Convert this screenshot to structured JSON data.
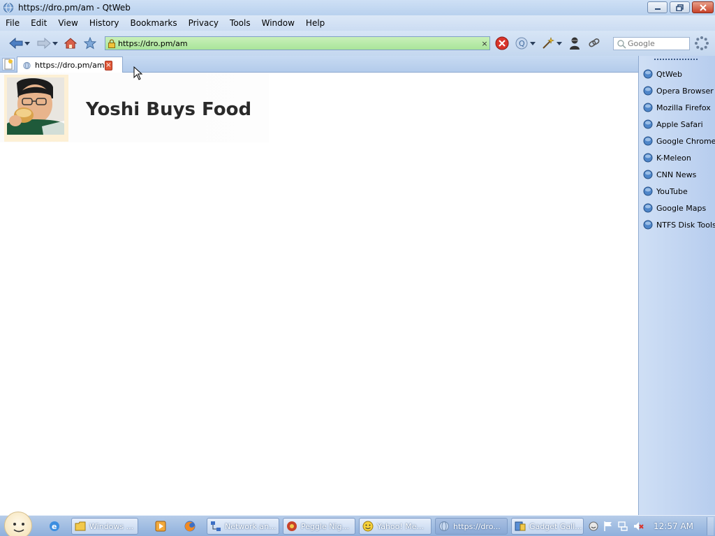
{
  "window": {
    "title": "https://dro.pm/am - QtWeb",
    "icon": "qtweb-globe-icon"
  },
  "menu": [
    "File",
    "Edit",
    "View",
    "History",
    "Bookmarks",
    "Privacy",
    "Tools",
    "Window",
    "Help"
  ],
  "toolbar": {
    "url": "https://dro.pm/am",
    "search_placeholder": "Google",
    "clear_glyph": "×",
    "url_color": "#a9e49a"
  },
  "tabs": [
    {
      "title": "https://dro.pm/am",
      "close_glyph": "×",
      "active": true
    }
  ],
  "page": {
    "site_title": "Yoshi Buys Food",
    "avatar_alt": "boy eating food"
  },
  "sidebar": {
    "bookmarks": [
      "QtWeb",
      "Opera Browser",
      "Mozilla Firefox",
      "Apple Safari",
      "Google Chrome",
      "K-Meleon",
      "CNN News",
      "YouTube",
      "Google Maps",
      "NTFS Disk Tools"
    ]
  },
  "taskbar": {
    "buttons": [
      {
        "label": "Windows ...",
        "icon": "folder-icon"
      },
      {
        "label": "Network an...",
        "icon": "network-icon"
      },
      {
        "label": "Peggle Nig...",
        "icon": "peggle-icon"
      },
      {
        "label": "Yahoo! Me...",
        "icon": "yahoo-messenger-icon"
      },
      {
        "label": "https://dro...",
        "icon": "qtweb-icon",
        "active": true
      },
      {
        "label": "Gadget Gall...",
        "icon": "gadget-icon"
      }
    ],
    "clock": "12:57 AM"
  }
}
